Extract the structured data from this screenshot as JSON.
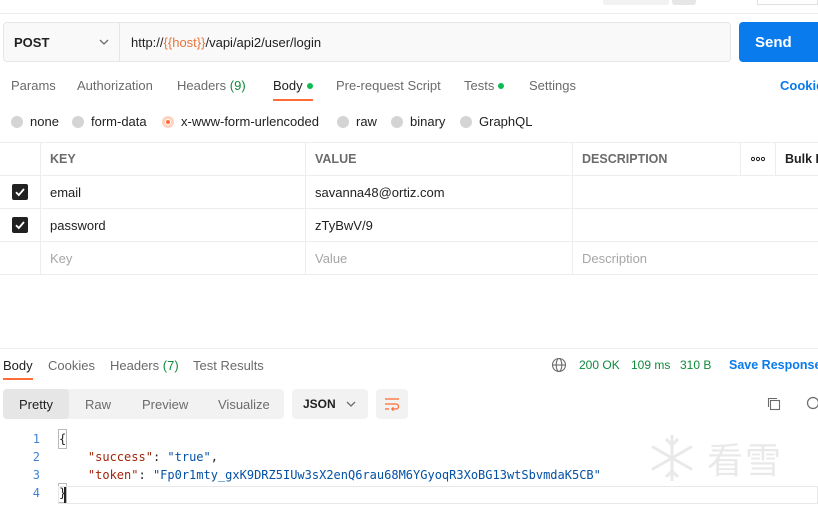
{
  "request": {
    "method": "POST",
    "url_prefix": "http://",
    "url_variable": "{{host}}",
    "url_suffix": "/vapi/api2/user/login",
    "send_label": "Send"
  },
  "request_tabs": {
    "params": "Params",
    "authorization": "Authorization",
    "headers": "Headers",
    "headers_count": "(9)",
    "body": "Body",
    "pre_request": "Pre-request Script",
    "tests": "Tests",
    "settings": "Settings",
    "cookies": "Cookie"
  },
  "body_types": {
    "none": "none",
    "form_data": "form-data",
    "urlencoded": "x-www-form-urlencoded",
    "raw": "raw",
    "binary": "binary",
    "graphql": "GraphQL",
    "selected": "x-www-form-urlencoded"
  },
  "table": {
    "headers": {
      "key": "KEY",
      "value": "VALUE",
      "description": "DESCRIPTION",
      "more": "ooo",
      "bulk_edit": "Bulk E"
    },
    "rows": [
      {
        "checked": true,
        "key": "email",
        "value": "savanna48@ortiz.com",
        "description": ""
      },
      {
        "checked": true,
        "key": "password",
        "value": "zTyBwV/9",
        "description": ""
      }
    ],
    "placeholder": {
      "key": "Key",
      "value": "Value",
      "description": "Description"
    }
  },
  "response_tabs": {
    "body": "Body",
    "cookies": "Cookies",
    "headers": "Headers",
    "headers_count": "(7)",
    "test_results": "Test Results"
  },
  "response_meta": {
    "status": "200 OK",
    "time": "109 ms",
    "size": "310 B",
    "save": "Save Response"
  },
  "view_modes": {
    "pretty": "Pretty",
    "raw": "Raw",
    "preview": "Preview",
    "visualize": "Visualize",
    "format": "JSON"
  },
  "code": {
    "lines": [
      {
        "num": "1",
        "text": "{"
      },
      {
        "num": "2",
        "key": "\"success\"",
        "sep": ": ",
        "value": "\"true\"",
        "tail": ","
      },
      {
        "num": "3",
        "key": "\"token\"",
        "sep": ": ",
        "value": "\"Fp0r1mty_gxK9DRZ5IUw3sX2enQ6rau68M6YGyoqR3XoBG13wtSbvmdaK5CB\"",
        "tail": ""
      },
      {
        "num": "4",
        "text": "}"
      }
    ]
  },
  "watermark": {
    "text": "看雪"
  },
  "colors": {
    "accent": "#ff6c37",
    "send": "#097bed",
    "status_ok": "#0e8a3b",
    "tab_dot": "#0cbb52"
  },
  "icons": {
    "method_dropdown": "chevron-down-icon",
    "globe": "globe-icon",
    "copy": "copy-icon",
    "search": "search-icon",
    "wrap": "wrap-lines-icon",
    "more": "more-horizontal-icon",
    "check": "checkbox-checked-icon"
  }
}
